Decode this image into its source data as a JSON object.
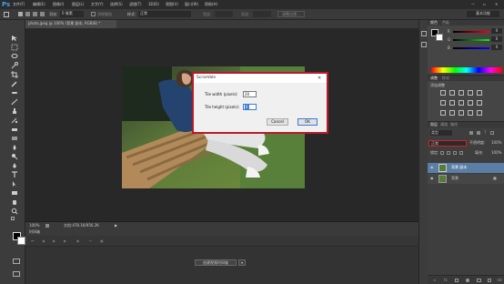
{
  "app": {
    "logo": "Ps",
    "menus": [
      "文件(F)",
      "编辑(E)",
      "图像(I)",
      "图层(L)",
      "文字(Y)",
      "选择(S)",
      "滤镜(T)",
      "3D(D)",
      "视图(V)",
      "窗口(W)",
      "帮助(H)"
    ],
    "window_controls": [
      "—",
      "▫",
      "✕"
    ]
  },
  "options_bar": {
    "feather_label": "羽化:",
    "feather_value": "0 像素",
    "antialias_label": "消除锯齿",
    "style_label": "样式:",
    "style_value": "正常",
    "width_label": "宽度:",
    "height_label": "高度:",
    "refine_edge": "调整边缘...",
    "workspace": "基本功能"
  },
  "document": {
    "tab_title": "photo.jpeg @ 100% (背景 副本, RGB/8) *",
    "zoom": "100%",
    "doc_size": "文档:478.1K/956.2K"
  },
  "timeline": {
    "title": "时间轴",
    "create_button": "创建视频时间轴"
  },
  "dialog": {
    "title": "Scramble",
    "close": "✕",
    "tile_width_label": "Tile width (pixels):",
    "tile_width_value": "20",
    "tile_height_label": "Tile height (pixels):",
    "tile_height_value": "0",
    "cancel": "Cancel",
    "ok": "OK"
  },
  "color_panel": {
    "tabs": [
      "颜色",
      "色板"
    ],
    "r": "R",
    "g": "G",
    "b": "B",
    "r_value": "0",
    "g_value": "0",
    "b_value": "0"
  },
  "adjustments_panel": {
    "tabs": [
      "调整",
      "样式"
    ],
    "subtitle": "添加调整"
  },
  "layers_panel": {
    "tabs": [
      "图层",
      "通道",
      "路径"
    ],
    "kind_label": "类型",
    "blend_mode": "正常",
    "opacity_label": "不透明度:",
    "opacity_value": "100%",
    "lock_label": "锁定:",
    "fill_label": "填充:",
    "fill_value": "100%",
    "layers": [
      {
        "name": "背景 副本",
        "selected": true
      },
      {
        "name": "背景",
        "selected": false
      }
    ]
  },
  "colors": {
    "accent_red": "#d11f2c",
    "ps_blue": "#3fa2e8",
    "selected_layer": "#5a7ea6"
  }
}
